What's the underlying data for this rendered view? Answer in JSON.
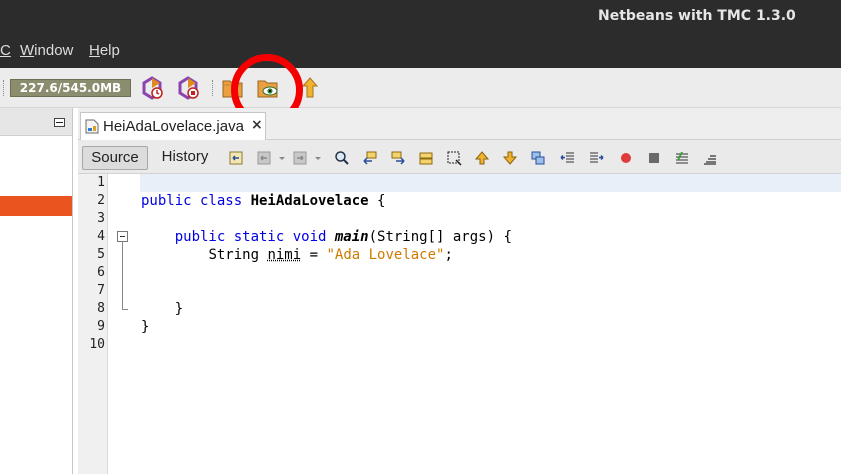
{
  "window": {
    "title": "Netbeans with TMC 1.3.0"
  },
  "menu": [
    {
      "label": "C",
      "underline_first": true
    },
    {
      "label": "Window",
      "underline_first": true
    },
    {
      "label": "Help",
      "underline_first": true
    }
  ],
  "toolbar": {
    "memory_label": "227.6/545.0MB",
    "icons": [
      "profile-snapshot-icon",
      "profile-stop-icon",
      "folder-icon",
      "folder-eye-icon",
      "upload-arrow-icon"
    ],
    "highlighted_icon": "folder-eye-icon",
    "highlight_color": "#f40000"
  },
  "left_panel": {
    "selected_color": "#e9541f"
  },
  "editor": {
    "tab": {
      "label": "HeiAdaLovelace.java",
      "close": "×"
    },
    "view_buttons": {
      "source": "Source",
      "history": "History"
    },
    "line_numbers": [
      "1",
      "2",
      "3",
      "4",
      "5",
      "6",
      "7",
      "8",
      "9",
      "10"
    ],
    "code": {
      "line2": {
        "kw": "public class ",
        "cls": "HeiAdaLovelace",
        "rest": " {"
      },
      "line4": {
        "kw": "public static void ",
        "method": "main",
        "rest": "(String[] args) {"
      },
      "line5": {
        "type": "String ",
        "var": "nimi",
        "eq": " = ",
        "str": "\"Ada Lovelace\"",
        "end": ";"
      },
      "line8": {
        "text": "}"
      },
      "line9": {
        "text": "}"
      }
    }
  }
}
